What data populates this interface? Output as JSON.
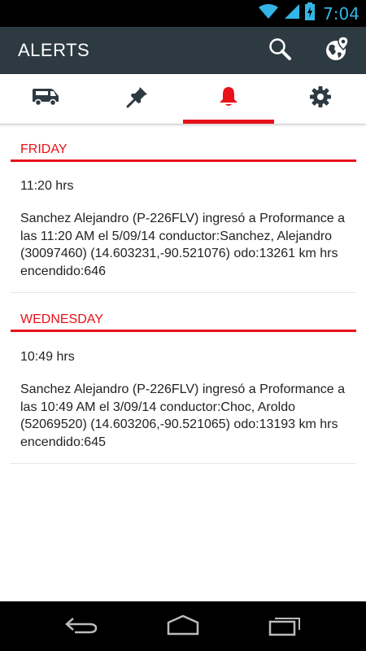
{
  "status_bar": {
    "time": "7:04",
    "accent": "#33b5e5"
  },
  "action_bar": {
    "title": "ALERTS",
    "background": "#2e3a42"
  },
  "tabs": [
    {
      "name": "vehicles",
      "icon": "van-icon",
      "active": false
    },
    {
      "name": "locations",
      "icon": "pushpin-icon",
      "active": false
    },
    {
      "name": "alerts",
      "icon": "bell-icon",
      "active": true
    },
    {
      "name": "settings",
      "icon": "gear-icon",
      "active": false
    }
  ],
  "accent_color": "#e8111a",
  "sections": [
    {
      "header": "FRIDAY",
      "alerts": [
        {
          "time": "11:20 hrs",
          "message": "Sanchez Alejandro (P-226FLV) ingresó a Proformance a las 11:20 AM el 5/09/14 conductor:Sanchez, Alejandro (30097460) (14.603231,-90.521076) odo:13261 km hrs encendido:646"
        }
      ]
    },
    {
      "header": "WEDNESDAY",
      "alerts": [
        {
          "time": "10:49 hrs",
          "message": "Sanchez Alejandro (P-226FLV) ingresó a Proformance a las 10:49 AM el 3/09/14 conductor:Choc, Aroldo (52069520) (14.603206,-90.521065) odo:13193 km hrs encendido:645"
        }
      ]
    }
  ]
}
